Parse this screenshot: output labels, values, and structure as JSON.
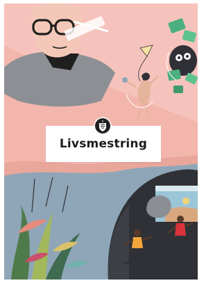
{
  "cover": {
    "title": "Livsmestring",
    "emblem_icon": "coat-of-arms-icon",
    "colors": {
      "background_pink": "#f3b6ad",
      "sky_pink": "#f6c9c4",
      "blue_gray": "#8fa6b8",
      "dark_slate": "#2f3136",
      "title_card": "#ffffff",
      "title_text": "#1c1c1c"
    }
  }
}
